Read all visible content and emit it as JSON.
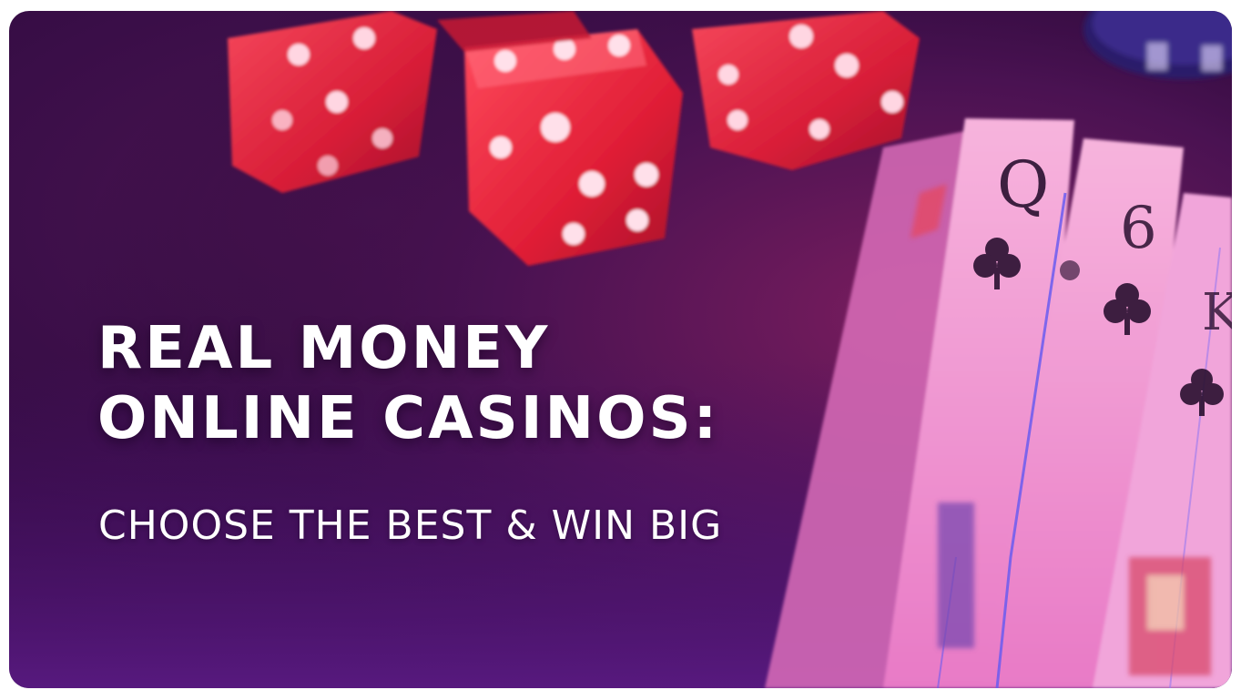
{
  "banner": {
    "headline_line1": "REAL MONEY",
    "headline_line2": "ONLINE CASINOS:",
    "subheadline": "CHOOSE THE BEST & WIN BIG"
  },
  "colors": {
    "background_dark": "#2a0838",
    "background_purple": "#5a1a7a",
    "dice_red": "#e8263c",
    "card_pink": "#f2a6d8",
    "text": "#ffffff"
  },
  "icons": [
    "dice-icon",
    "playing-card-icon",
    "clubs-suit-icon",
    "poker-chip-icon"
  ]
}
